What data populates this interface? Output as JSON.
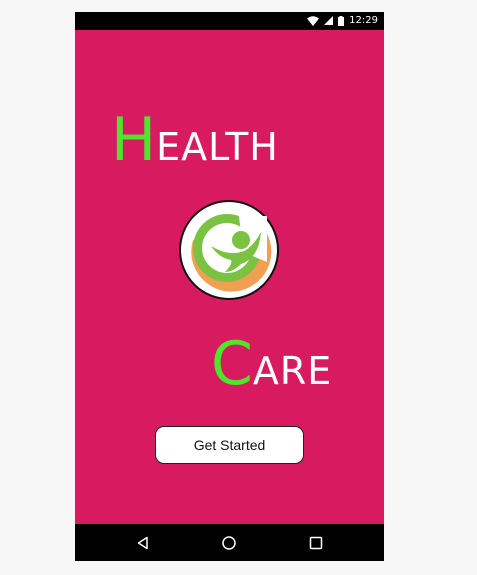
{
  "status_bar": {
    "time": "12:29",
    "icons": [
      "wifi-icon",
      "signal-icon",
      "battery-icon"
    ]
  },
  "title": {
    "word1_cap": "H",
    "word1_rest": "EALTH",
    "word2_cap": "C",
    "word2_rest": "ARE"
  },
  "logo": {
    "icon": "health-person-logo"
  },
  "button": {
    "label": "Get Started"
  },
  "nav_bar": {
    "buttons": [
      "back-icon",
      "home-icon",
      "recent-apps-icon"
    ]
  },
  "colors": {
    "background": "#d81b60",
    "accent_letter": "#4de62a",
    "logo_green": "#7cc242",
    "logo_orange": "#f0a050"
  }
}
